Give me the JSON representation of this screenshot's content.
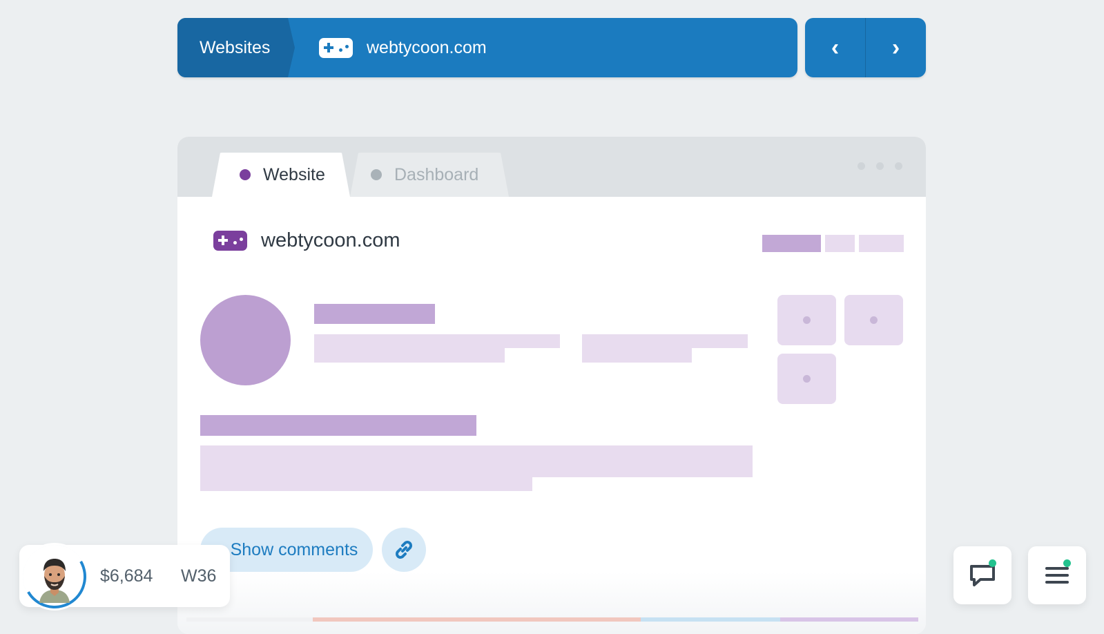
{
  "topbar": {
    "root_label": "Websites",
    "site_name": "webtycoon.com",
    "site_icon": "gamepad-icon",
    "prev_icon": "chevron-left-icon",
    "next_icon": "chevron-right-icon",
    "prev_glyph": "‹",
    "next_glyph": "›",
    "color": "#1b7bbf",
    "root_color": "#1867a2"
  },
  "browser": {
    "tabs": [
      {
        "label": "Website",
        "active": true,
        "dot_color": "#7a3e9d"
      },
      {
        "label": "Dashboard",
        "active": false,
        "dot_color": "#a9b2b8"
      }
    ],
    "site_name": "webtycoon.com",
    "site_icon": "gamepad-icon",
    "show_comments_label": "Show comments",
    "link_icon": "link-icon"
  },
  "profile": {
    "money": "$6,684",
    "week": "W36",
    "avatar_icon": "avatar-icon"
  },
  "actions": [
    {
      "icon": "chat-icon",
      "has_notification": true
    },
    {
      "icon": "menu-icon",
      "has_notification": true
    }
  ],
  "colors": {
    "page_background": "#eceff1",
    "accent_blue": "#1b7bbf",
    "accent_purple": "#7a3e9d",
    "notification_green": "#23c28e"
  }
}
